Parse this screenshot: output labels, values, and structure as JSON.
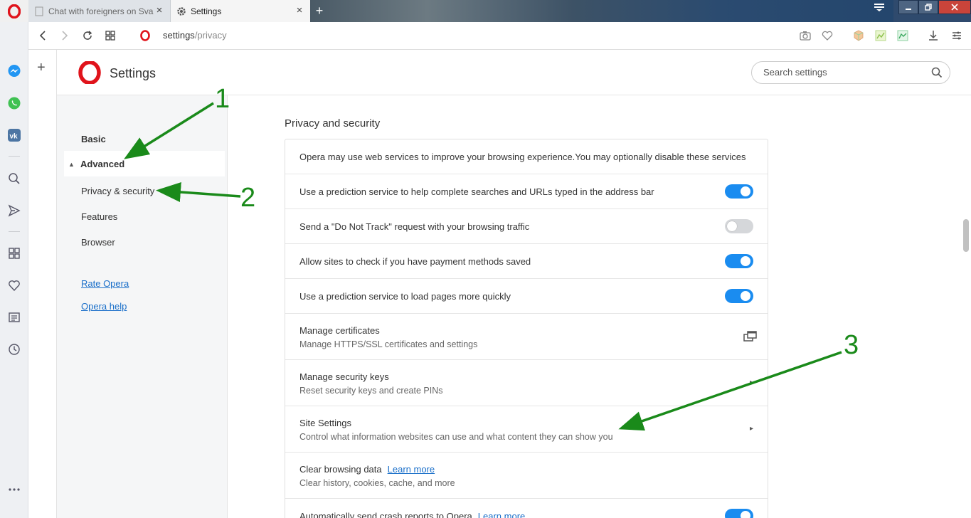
{
  "browser": {
    "tabs": [
      {
        "title": "Chat with foreigners on Sva",
        "active": false
      },
      {
        "title": "Settings",
        "active": true
      }
    ],
    "address": {
      "host": "settings",
      "path": "/privacy"
    }
  },
  "sidebar_icons": [
    "messenger-icon",
    "whatsapp-icon",
    "vk-icon",
    "search-icon",
    "send-icon",
    "speed-dial-icon",
    "heart-icon",
    "news-icon",
    "history-icon",
    "more-icon"
  ],
  "settings": {
    "title": "Settings",
    "search_placeholder": "Search settings"
  },
  "nav": {
    "basic": "Basic",
    "advanced": "Advanced",
    "privacy": "Privacy & security",
    "features": "Features",
    "browser": "Browser",
    "rate": "Rate Opera",
    "help": "Opera help"
  },
  "section": {
    "title": "Privacy and security",
    "rows": [
      {
        "label": "Opera may use web services to improve your browsing experience.You may optionally disable these services"
      },
      {
        "label": "Use a prediction service to help complete searches and URLs typed in the address bar",
        "toggle": true
      },
      {
        "label": "Send a \"Do Not Track\" request with your browsing traffic",
        "toggle": false
      },
      {
        "label": "Allow sites to check if you have payment methods saved",
        "toggle": true
      },
      {
        "label": "Use a prediction service to load pages more quickly",
        "toggle": true
      },
      {
        "label": "Manage certificates",
        "sub": "Manage HTTPS/SSL certificates and settings"
      },
      {
        "label": "Manage security keys",
        "sub": "Reset security keys and create PINs"
      },
      {
        "label": "Site Settings",
        "sub": "Control what information websites can use and what content they can show you"
      },
      {
        "label": "Clear browsing data",
        "link": "Learn more",
        "sub": "Clear history, cookies, cache, and more"
      },
      {
        "label": "Automatically send crash reports to Opera",
        "link": "Learn more",
        "toggle": true
      }
    ]
  },
  "annotations": [
    "1",
    "2",
    "3"
  ],
  "colors": {
    "accent": "#1a8cf0",
    "link": "#1a6fc9",
    "annotation": "#1a8a1a",
    "opera_red": "#e0131b"
  }
}
